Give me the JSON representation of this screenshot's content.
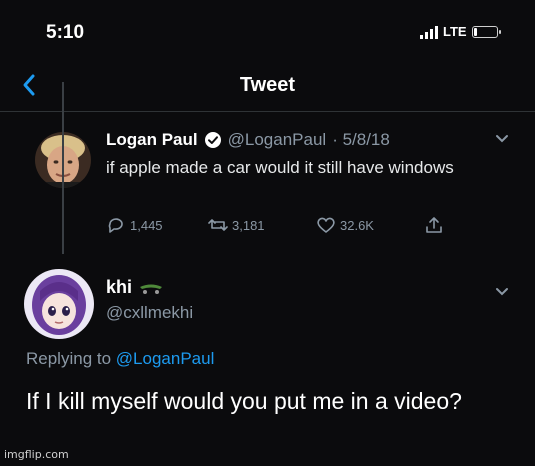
{
  "status_bar": {
    "time": "5:10",
    "carrier": "LTE",
    "battery_level": 0.15
  },
  "header": {
    "title": "Tweet"
  },
  "tweet": {
    "author_name": "Logan Paul",
    "author_handle": "@LoganPaul",
    "date": "· 5/8/18",
    "text": "if apple made a car would it still have windows",
    "replies": "1,445",
    "retweets": "3,181",
    "likes": "32.6K"
  },
  "reply": {
    "author_name": "khi",
    "author_handle": "@cxllmekhi",
    "replying_prefix": "Replying to",
    "replying_to": "@LoganPaul",
    "text": "If I kill myself would you put me in a video?"
  },
  "watermark": "imgflip.com",
  "colors": {
    "background": "#0b0b0d",
    "accent": "#1d9bf0",
    "muted": "#8b98a5",
    "verified": "#ffffff"
  },
  "icons": [
    "back-icon",
    "verified-icon",
    "caret-down-icon",
    "reply-icon",
    "retweet-icon",
    "like-icon",
    "share-icon",
    "skateboard-emoji-icon",
    "signal-icon",
    "battery-icon"
  ]
}
